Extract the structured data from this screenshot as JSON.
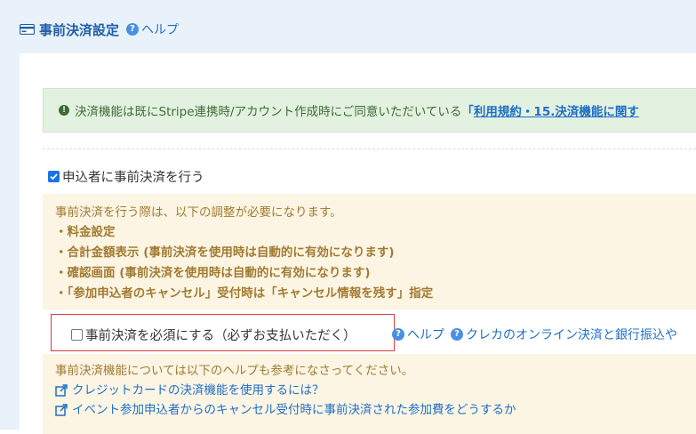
{
  "header": {
    "title": "事前決済設定",
    "help_label": "ヘルプ"
  },
  "alert": {
    "text": "決済機能は既にStripe連携時/アカウント作成時にご同意いただいている",
    "bracket_open": "「",
    "link_text": "利用規約・15.決済機能に関す"
  },
  "prepay_checkbox": {
    "label": "申込者に事前決済を行う",
    "checked": true
  },
  "notice": {
    "intro": "事前決済を行う際は、以下の調整が必要になります。",
    "items": [
      "・料金設定",
      "・合計金額表示 (事前決済を使用時は自動的に有効になります)",
      "・確認画面 (事前決済を使用時は自動的に有効になります)",
      "・「参加申込者のキャンセル」受付時は「キャンセル情報を残す」指定"
    ]
  },
  "required_checkbox": {
    "label": "事前決済を必須にする（必ずお支払いただく）",
    "checked": false
  },
  "right_links": {
    "help_label": "ヘルプ",
    "card_bank_label": "クレカのオンライン決済と銀行振込や"
  },
  "help_notice": {
    "intro": "事前決済機能については以下のヘルプも参考になさってください。",
    "links": [
      "クレジットカードの決済機能を使用するには？",
      "イベント参加申込者からのキャンセル受付時に事前決済された参加費をどうするか"
    ]
  },
  "colors": {
    "accent": "#1f5fa8",
    "link": "#1f6fc5",
    "notice_text": "#a27b32",
    "notice_bg": "#fcf5e4",
    "success_bg": "#e3f1e0",
    "highlight_border": "#d63b3b"
  },
  "icons": [
    "credit-card-icon",
    "help-icon",
    "exclamation-icon",
    "check-icon",
    "external-link-icon"
  ]
}
